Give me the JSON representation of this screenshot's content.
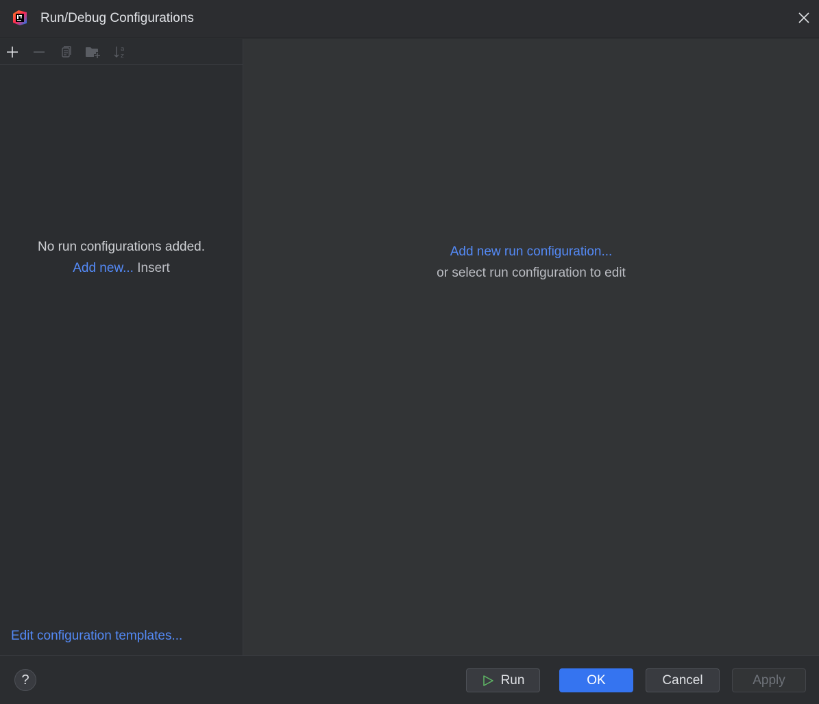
{
  "window": {
    "title": "Run/Debug Configurations",
    "logo_icon": "intellij-idea-logo-icon",
    "close_icon": "close-icon"
  },
  "toolbar": {
    "items": [
      {
        "name": "add",
        "icon": "plus-icon",
        "enabled": true
      },
      {
        "name": "remove",
        "icon": "minus-icon",
        "enabled": false
      },
      {
        "name": "copy",
        "icon": "copy-icon",
        "enabled": false
      },
      {
        "name": "new-folder",
        "icon": "folder-add-icon",
        "enabled": false
      },
      {
        "name": "sort",
        "icon": "sort-alphabetically-icon",
        "enabled": false
      }
    ]
  },
  "left_panel": {
    "empty_message": "No run configurations added.",
    "add_new_link": "Add new...",
    "add_new_shortcut": "Insert",
    "templates_link": "Edit configuration templates..."
  },
  "right_panel": {
    "add_link": "Add new run configuration...",
    "hint": "or select run configuration to edit"
  },
  "footer": {
    "help_label": "?",
    "run_label": "Run",
    "ok_label": "OK",
    "cancel_label": "Cancel",
    "apply_label": "Apply",
    "apply_enabled": false
  },
  "colors": {
    "background": "#323436",
    "panel": "#2b2d30",
    "link": "#548af7",
    "primary_button": "#3574f0",
    "run_icon": "#5fb865"
  }
}
